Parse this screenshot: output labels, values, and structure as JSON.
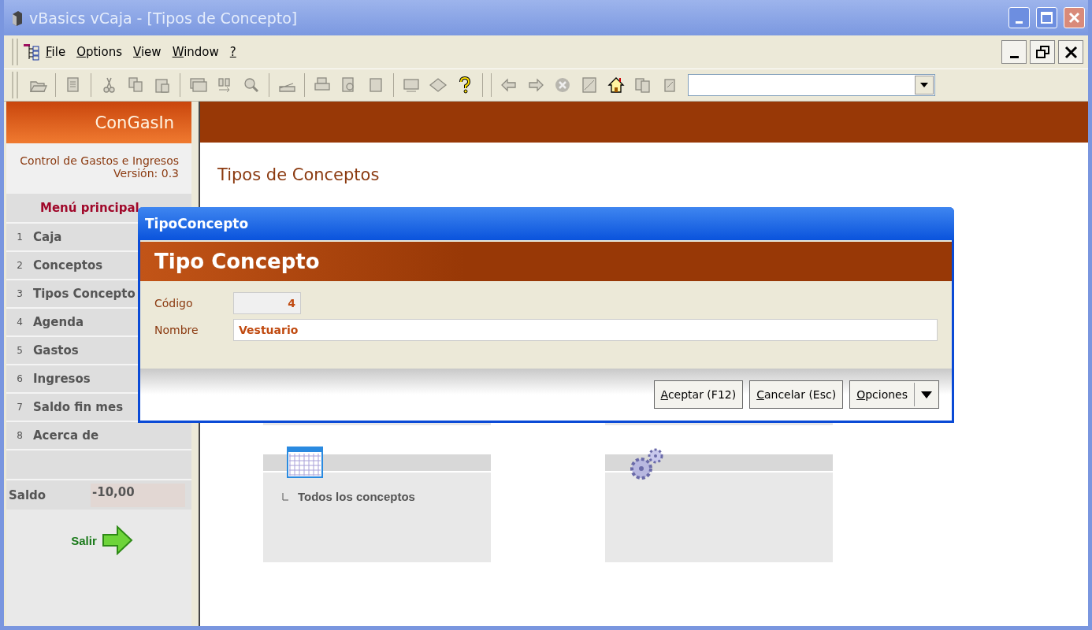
{
  "window": {
    "title": "vBasics vCaja - [Tipos de Concepto]"
  },
  "menu": [
    "File",
    "Options",
    "View",
    "Window",
    "?"
  ],
  "sidebar": {
    "app_name": "ConGasIn",
    "subtitle": "Control de Gastos e Ingresos",
    "version": "Versión: 0.3",
    "menu_title": "Menú principal",
    "items": [
      {
        "number": "1",
        "label": "Caja"
      },
      {
        "number": "2",
        "label": "Conceptos"
      },
      {
        "number": "3",
        "label": "Tipos Concepto"
      },
      {
        "number": "4",
        "label": "Agenda"
      },
      {
        "number": "5",
        "label": "Gastos"
      },
      {
        "number": "6",
        "label": "Ingresos"
      },
      {
        "number": "7",
        "label": "Saldo fin mes"
      },
      {
        "number": "8",
        "label": "Acerca de"
      }
    ],
    "balance_label": "Saldo",
    "balance_value": "-10,00",
    "exit_label": "Salir"
  },
  "content": {
    "title": "Tipos de Conceptos",
    "cards": [
      {
        "kind": "calendar",
        "links": [
          "Todos los conceptos"
        ]
      },
      {
        "kind": "gears"
      }
    ]
  },
  "dialog": {
    "title": "TipoConcepto",
    "header": "Tipo Concepto",
    "fields": [
      {
        "label": "Código",
        "value": "4",
        "disabled": true
      },
      {
        "label": "Nombre",
        "value": "Vestuario",
        "disabled": false
      }
    ],
    "buttons": [
      "Aceptar (F12)",
      "Cancelar (Esc)",
      "Opciones"
    ]
  }
}
